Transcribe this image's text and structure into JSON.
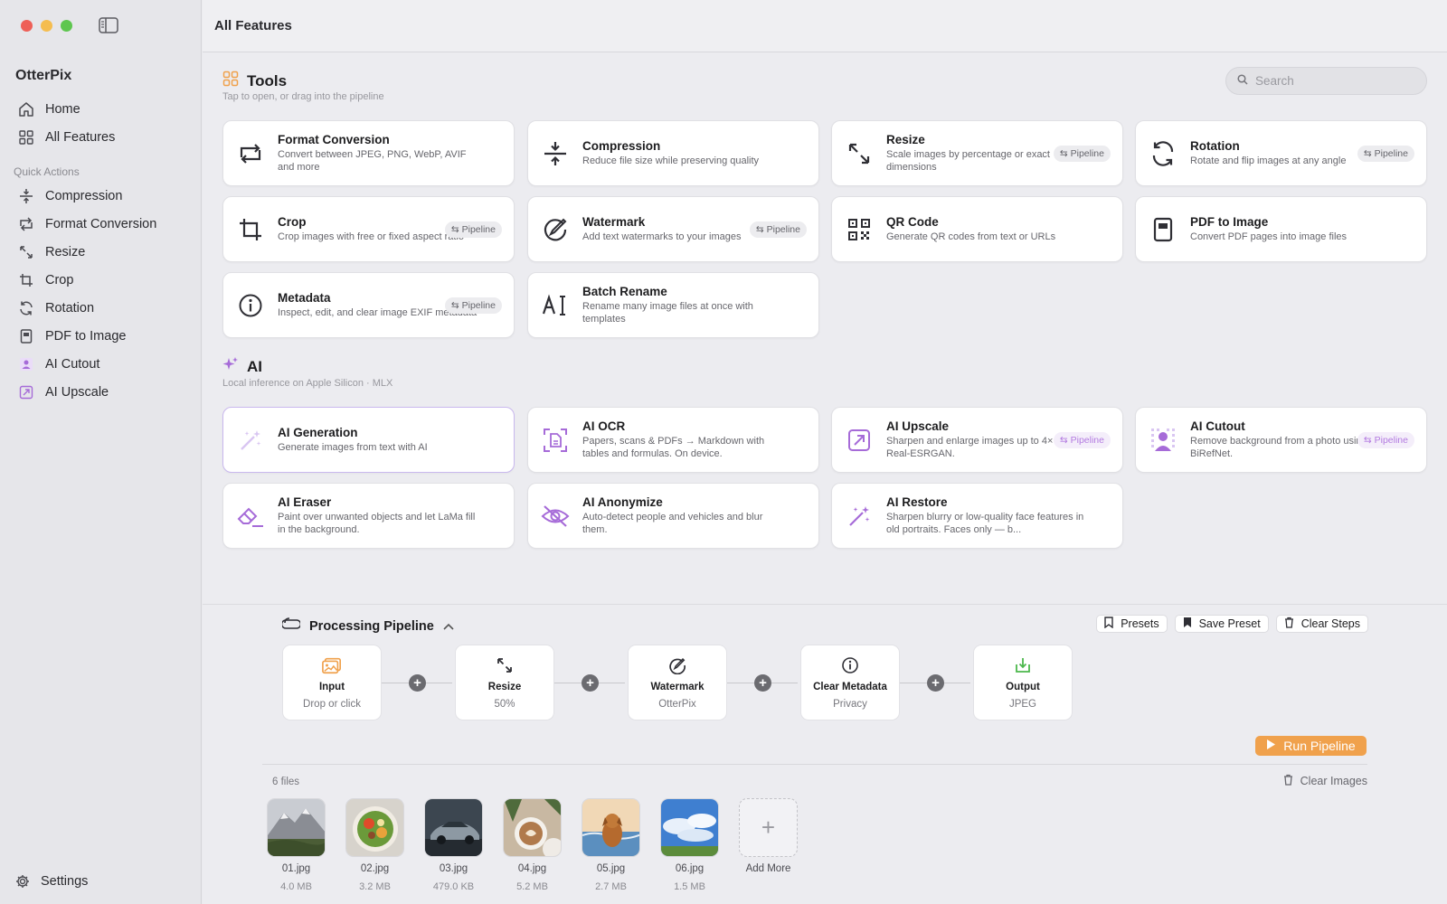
{
  "window": {
    "title": "All Features"
  },
  "sidebar": {
    "app_name": "OtterPix",
    "nav": [
      {
        "label": "Home",
        "icon": "house-icon"
      },
      {
        "label": "All Features",
        "icon": "grid-icon"
      }
    ],
    "quick_actions_title": "Quick Actions",
    "quick_actions": [
      {
        "label": "Compression",
        "icon": "compress-icon"
      },
      {
        "label": "Format Conversion",
        "icon": "convert-icon"
      },
      {
        "label": "Resize",
        "icon": "resize-icon"
      },
      {
        "label": "Crop",
        "icon": "crop-icon"
      },
      {
        "label": "Rotation",
        "icon": "rotate-icon"
      },
      {
        "label": "PDF to Image",
        "icon": "pdf-icon"
      },
      {
        "label": "AI Cutout",
        "icon": "ai-cutout-icon"
      },
      {
        "label": "AI Upscale",
        "icon": "ai-upscale-icon"
      }
    ],
    "settings_label": "Settings"
  },
  "search": {
    "placeholder": "Search"
  },
  "tools": {
    "title": "Tools",
    "subtitle": "Tap to open, or drag into the pipeline",
    "cards": [
      {
        "title": "Format Conversion",
        "desc": "Convert between JPEG, PNG, WebP, AVIF and more",
        "pill": ""
      },
      {
        "title": "Compression",
        "desc": "Reduce file size while preserving quality",
        "pill": ""
      },
      {
        "title": "Resize",
        "desc": "Scale images by percentage or exact dimensions",
        "pill": "Pipeline"
      },
      {
        "title": "Rotation",
        "desc": "Rotate and flip images at any angle",
        "pill": "Pipeline"
      },
      {
        "title": "Crop",
        "desc": "Crop images with free or fixed aspect ratio",
        "pill": "Pipeline"
      },
      {
        "title": "Watermark",
        "desc": "Add text watermarks to your images",
        "pill": "Pipeline"
      },
      {
        "title": "QR Code",
        "desc": "Generate QR codes from text or URLs",
        "pill": ""
      },
      {
        "title": "PDF to Image",
        "desc": "Convert PDF pages into image files",
        "pill": ""
      },
      {
        "title": "Metadata",
        "desc": "Inspect, edit, and clear image EXIF metadata",
        "pill": "Pipeline"
      },
      {
        "title": "Batch Rename",
        "desc": "Rename many image files at once with templates",
        "pill": ""
      }
    ]
  },
  "ai": {
    "title": "AI",
    "subtitle": "Local inference on Apple Silicon · MLX",
    "cards": [
      {
        "title": "AI Generation",
        "desc": "Generate images from text with AI",
        "pill": ""
      },
      {
        "title": "AI OCR",
        "desc": "Papers, scans & PDFs → Markdown with tables and formulas. On device.",
        "pill": ""
      },
      {
        "title": "AI Upscale",
        "desc": "Sharpen and enlarge images up to 4× with Real-ESRGAN.",
        "pill": "Pipeline"
      },
      {
        "title": "AI Cutout",
        "desc": "Remove background from a photo using BiRefNet.",
        "pill": "Pipeline"
      },
      {
        "title": "AI Eraser",
        "desc": "Paint over unwanted objects and let LaMa fill in the background.",
        "pill": ""
      },
      {
        "title": "AI Anonymize",
        "desc": "Auto-detect people and vehicles and blur them.",
        "pill": ""
      },
      {
        "title": "AI Restore",
        "desc": "Sharpen blurry or low-quality face features in old portraits. Faces only — b...",
        "pill": ""
      }
    ]
  },
  "pipeline": {
    "title": "Processing Pipeline",
    "buttons": {
      "presets": "Presets",
      "save_preset": "Save Preset",
      "clear_steps": "Clear Steps"
    },
    "steps": [
      {
        "label": "Input",
        "sub": "Drop or click"
      },
      {
        "label": "Resize",
        "sub": "50%"
      },
      {
        "label": "Watermark",
        "sub": "OtterPix"
      },
      {
        "label": "Clear Metadata",
        "sub": "Privacy"
      },
      {
        "label": "Output",
        "sub": "JPEG"
      }
    ],
    "run_label": "Run Pipeline",
    "files_count": "6 files",
    "clear_images": "Clear Images",
    "files": [
      {
        "name": "01.jpg",
        "size": "4.0 MB"
      },
      {
        "name": "02.jpg",
        "size": "3.2 MB"
      },
      {
        "name": "03.jpg",
        "size": "479.0 KB"
      },
      {
        "name": "04.jpg",
        "size": "5.2 MB"
      },
      {
        "name": "05.jpg",
        "size": "2.7 MB"
      },
      {
        "name": "06.jpg",
        "size": "1.5 MB"
      }
    ],
    "add_more": "Add More"
  },
  "colors": {
    "accent": "#f0a14c",
    "ai_purple": "#a66bd8",
    "selected_border": "#c9b8ee"
  }
}
